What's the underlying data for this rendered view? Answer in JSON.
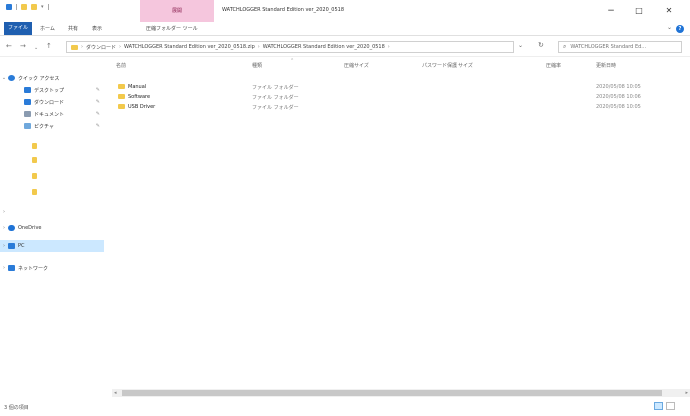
{
  "titlebar": {
    "context_tab": "展開",
    "title": "WATCHLOGGER Standard Edition ver_2020_0518",
    "minimize": "−",
    "maximize": "□",
    "close": "✕"
  },
  "ribbon": {
    "tabs": [
      "ファイル",
      "ホーム",
      "共有",
      "表示",
      "圧縮フォルダー ツール"
    ]
  },
  "nav": {
    "back": "←",
    "forward": "→",
    "recent": "⌄",
    "up": "↑",
    "breadcrumbs": [
      "ダウンロード",
      "WATCHLOGGER Standard Edition ver_2020_0518.zip",
      "WATCHLOGGER Standard Edition ver_2020_0518"
    ],
    "crumb_sep": "›",
    "dropdown": "⌄",
    "refresh": "↻",
    "search_placeholder": "WATCHLOGGER Standard Ed..."
  },
  "sidebar": {
    "items": [
      {
        "label": "クイック アクセス",
        "expander": "⌄",
        "icon": "star-icon",
        "color": "#2a7bd8"
      },
      {
        "label": "デスクトップ",
        "expander": "",
        "icon": "desktop-icon",
        "color": "#2a7bd8",
        "pinned": true
      },
      {
        "label": "ダウンロード",
        "expander": "",
        "icon": "download-icon",
        "color": "#2a7bd8",
        "pinned": true
      },
      {
        "label": "ドキュメント",
        "expander": "",
        "icon": "document-icon",
        "color": "#8a9bb0",
        "pinned": true
      },
      {
        "label": "ピクチャ",
        "expander": "",
        "icon": "picture-icon",
        "color": "#6fa8dc",
        "pinned": true
      },
      {
        "label": "",
        "expander": "",
        "icon": "folder-icon",
        "color": "#f2c94c"
      },
      {
        "label": "",
        "expander": "",
        "icon": "folder-icon",
        "color": "#f2c94c"
      },
      {
        "label": "",
        "expander": "",
        "icon": "folder-icon",
        "color": "#f2c94c"
      },
      {
        "label": "",
        "expander": "",
        "icon": "folder-icon",
        "color": "#f2c94c"
      },
      {
        "label": "",
        "expander": "›",
        "icon": "none",
        "color": "#ffffff"
      },
      {
        "label": "OneDrive",
        "expander": "›",
        "icon": "cloud-icon",
        "color": "#1f73d6"
      },
      {
        "label": "PC",
        "expander": "›",
        "icon": "pc-icon",
        "color": "#2a7bd8",
        "selected": true
      },
      {
        "label": "ネットワーク",
        "expander": "›",
        "icon": "network-icon",
        "color": "#2a7bd8"
      }
    ]
  },
  "columns": {
    "name": "名前",
    "type": "種類",
    "compressed_size": "圧縮サイズ",
    "password": "パスワード保護",
    "size": "サイズ",
    "ratio": "圧縮率",
    "modified": "更新日時"
  },
  "files": [
    {
      "name": "Manual",
      "type": "ファイル フォルダー",
      "modified": "2020/05/08 10:05"
    },
    {
      "name": "Software",
      "type": "ファイル フォルダー",
      "modified": "2020/05/08 10:06"
    },
    {
      "name": "USB Driver",
      "type": "ファイル フォルダー",
      "modified": "2020/05/08 10:05"
    }
  ],
  "statusbar": {
    "count": "3 個の項目"
  },
  "colors": {
    "accent": "#1f5fb0",
    "selection": "#cce8ff",
    "folder": "#f2c94c",
    "context_tab": "#f5c6dd"
  }
}
